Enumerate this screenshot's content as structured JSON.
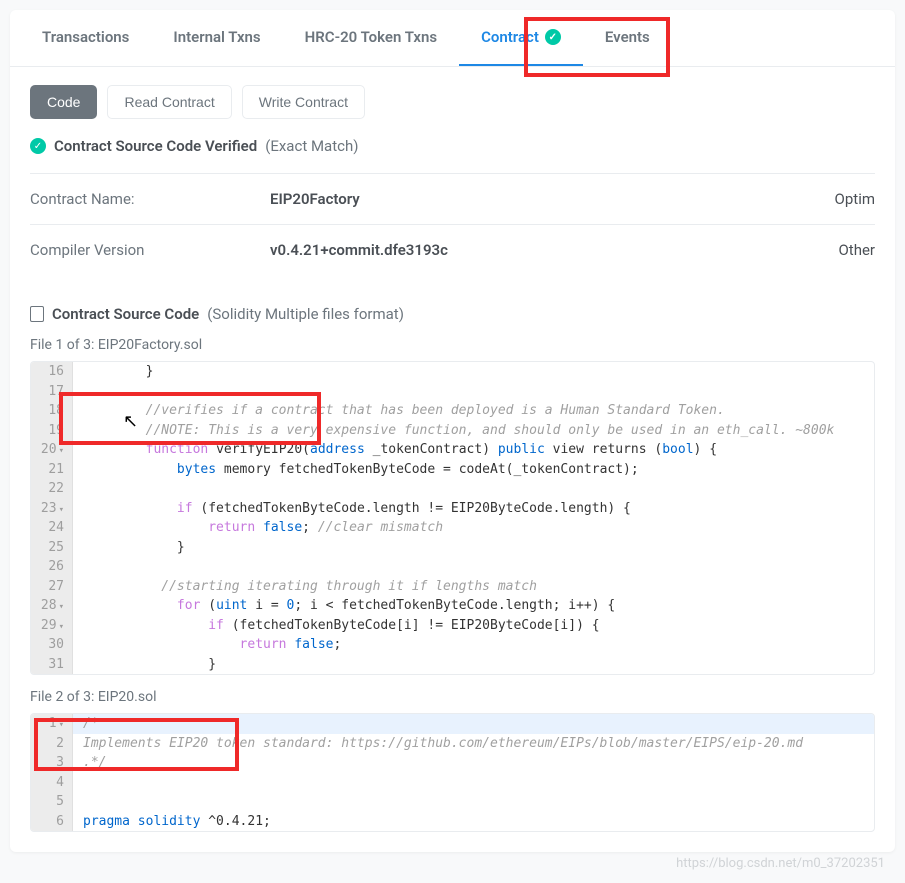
{
  "tabs": {
    "transactions": "Transactions",
    "internal": "Internal Txns",
    "hrc20": "HRC-20 Token Txns",
    "contract": "Contract",
    "events": "Events"
  },
  "subtabs": {
    "code": "Code",
    "read": "Read Contract",
    "write": "Write Contract"
  },
  "verify": {
    "label": "Contract Source Code Verified",
    "match": "(Exact Match)"
  },
  "info": {
    "name_label": "Contract Name:",
    "name_value": "EIP20Factory",
    "compiler_label": "Compiler Version",
    "compiler_value": "v0.4.21+commit.dfe3193c",
    "optim": "Optim",
    "other": "Other"
  },
  "source": {
    "title": "Contract Source Code",
    "format": "(Solidity Multiple files format)"
  },
  "file1": {
    "label": "File 1 of 3: EIP20Factory.sol",
    "lines": [
      {
        "n": "16",
        "t": "        }"
      },
      {
        "n": "17",
        "t": ""
      },
      {
        "n": "18",
        "t": "        //verifies if a contract that has been deployed is a Human Standard Token.",
        "cls": "c-comment"
      },
      {
        "n": "19",
        "t": "        //NOTE: This is a very expensive function, and should only be used in an eth_call. ~800k",
        "cls": "c-comment"
      },
      {
        "n": "20",
        "fold": true,
        "tokens": [
          [
            "        "
          ],
          [
            "function",
            "c-kw"
          ],
          [
            " verifyEIP20("
          ],
          [
            "address",
            "c-blue"
          ],
          [
            " _tokenContract) "
          ],
          [
            "public",
            "c-blue"
          ],
          [
            " view returns ("
          ],
          [
            "bool",
            "c-blue"
          ],
          [
            ") {"
          ]
        ]
      },
      {
        "n": "21",
        "tokens": [
          [
            "            "
          ],
          [
            "bytes",
            "c-blue"
          ],
          [
            " memory fetchedTokenByteCode = codeAt(_tokenContract);"
          ]
        ]
      },
      {
        "n": "22",
        "t": ""
      },
      {
        "n": "23",
        "fold": true,
        "tokens": [
          [
            "            "
          ],
          [
            "if",
            "c-kw"
          ],
          [
            " (fetchedTokenByteCode.length != EIP20ByteCode.length) {"
          ]
        ]
      },
      {
        "n": "24",
        "tokens": [
          [
            "                "
          ],
          [
            "return",
            "c-kw"
          ],
          [
            " "
          ],
          [
            "false",
            "c-blue"
          ],
          [
            "; "
          ],
          [
            "//clear mismatch",
            "c-comment"
          ]
        ]
      },
      {
        "n": "25",
        "t": "            }"
      },
      {
        "n": "26",
        "t": ""
      },
      {
        "n": "27",
        "t": "          //starting iterating through it if lengths match",
        "cls": "c-comment"
      },
      {
        "n": "28",
        "fold": true,
        "tokens": [
          [
            "            "
          ],
          [
            "for",
            "c-kw"
          ],
          [
            " ("
          ],
          [
            "uint",
            "c-blue"
          ],
          [
            " i = "
          ],
          [
            "0",
            "c-blue"
          ],
          [
            "; i < fetchedTokenByteCode.length; i++) {"
          ]
        ]
      },
      {
        "n": "29",
        "fold": true,
        "tokens": [
          [
            "                "
          ],
          [
            "if",
            "c-kw"
          ],
          [
            " (fetchedTokenByteCode[i] != EIP20ByteCode[i]) {"
          ]
        ]
      },
      {
        "n": "30",
        "tokens": [
          [
            "                    "
          ],
          [
            "return",
            "c-kw"
          ],
          [
            " "
          ],
          [
            "false",
            "c-blue"
          ],
          [
            ";"
          ]
        ]
      },
      {
        "n": "31",
        "t": "                }"
      }
    ]
  },
  "file2": {
    "label": "File 2 of 3: EIP20.sol",
    "lines": [
      {
        "n": "1",
        "fold": true,
        "hl": true,
        "t": "/*",
        "cls": "c-comment"
      },
      {
        "n": "2",
        "t": "Implements EIP20 token standard: https://github.com/ethereum/EIPs/blob/master/EIPS/eip-20.md",
        "cls": "c-comment"
      },
      {
        "n": "3",
        "t": ".*/",
        "cls": "c-comment"
      },
      {
        "n": "4",
        "t": ""
      },
      {
        "n": "5",
        "t": ""
      },
      {
        "n": "6",
        "tokens": [
          [
            "pragma solidity ",
            "c-blue"
          ],
          [
            "^0.4.21;"
          ]
        ]
      }
    ]
  },
  "watermark": "https://blog.csdn.net/m0_37202351"
}
